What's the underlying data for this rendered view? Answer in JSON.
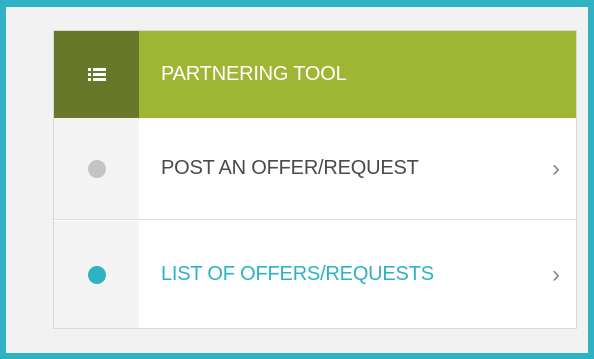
{
  "menu": {
    "header": {
      "title": "PARTNERING TOOL",
      "icon": "list-icon"
    },
    "items": [
      {
        "label": "POST AN OFFER/REQUEST",
        "icon": "dot-icon",
        "status_color": "#c4c4c4",
        "active": false
      },
      {
        "label": "LIST OF OFFERS/REQUESTS",
        "icon": "dot-icon",
        "status_color": "#2eb2c4",
        "active": true
      }
    ],
    "chevron": "›"
  },
  "colors": {
    "accent": "#2eb2c4",
    "header_green": "#9fb634",
    "header_dark_green": "#67782a"
  }
}
